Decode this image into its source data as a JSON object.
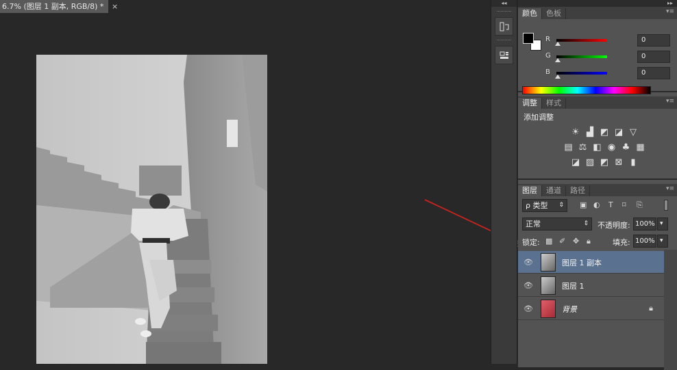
{
  "document": {
    "tab_title": "6.7% (图层 1 副本, RGB/8) *",
    "close_symbol": "×"
  },
  "strip": {
    "collapse_symbol": "◂◂",
    "tools": [
      {
        "icon": "history-icon"
      },
      {
        "icon": "properties-icon"
      }
    ]
  },
  "panels": {
    "expand_symbol": "▸▸",
    "color_panel": {
      "tabs": [
        "颜色",
        "色板"
      ],
      "active_tab": 0,
      "menu_symbol": "▾≡",
      "foreground": "#000000",
      "background": "#ffffff",
      "channels": [
        {
          "label": "R",
          "value": "0",
          "color": "#d01010"
        },
        {
          "label": "G",
          "value": "0",
          "color": "#10c010"
        },
        {
          "label": "B",
          "value": "0",
          "color": "#1010d0"
        }
      ]
    },
    "adjust_panel": {
      "tabs": [
        "调整",
        "样式"
      ],
      "active_tab": 0,
      "heading": "添加调整",
      "icon_rows": [
        [
          "brightness-icon",
          "levels-icon",
          "curves-icon",
          "exposure-icon",
          "vibrance-icon"
        ],
        [
          "hue-saturation-icon",
          "color-balance-icon",
          "black-white-icon",
          "photo-filter-icon",
          "channel-mixer-icon",
          "color-lookup-icon"
        ],
        [
          "invert-icon",
          "posterize-icon",
          "threshold-icon",
          "selective-color-icon",
          "gradient-map-icon"
        ]
      ]
    },
    "layers_panel": {
      "tabs": [
        "图层",
        "通道",
        "路径"
      ],
      "active_tab": 0,
      "filter_label": "ρ 类型",
      "blend_mode": "正常",
      "opacity_label": "不透明度:",
      "opacity_value": "100%",
      "lock_label": "锁定:",
      "fill_label": "填充:",
      "fill_value": "100%",
      "layers": [
        {
          "name": "图层 1 副本",
          "selected": true,
          "locked": false
        },
        {
          "name": "图层 1",
          "selected": false,
          "locked": false
        },
        {
          "name": "背景",
          "selected": false,
          "locked": true
        }
      ]
    }
  }
}
